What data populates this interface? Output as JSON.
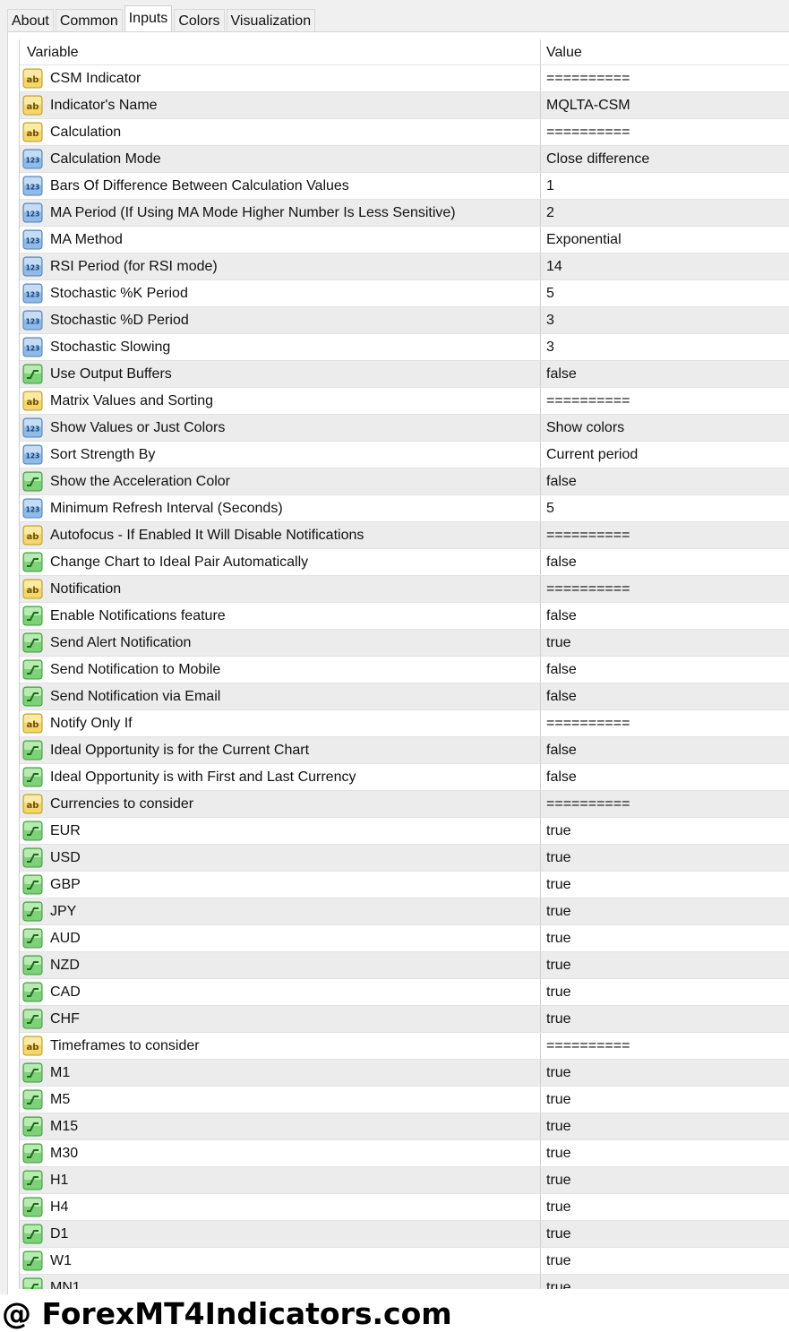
{
  "tabs": [
    {
      "label": "About",
      "active": false
    },
    {
      "label": "Common",
      "active": false
    },
    {
      "label": "Inputs",
      "active": true
    },
    {
      "label": "Colors",
      "active": false
    },
    {
      "label": "Visualization",
      "active": false
    }
  ],
  "table": {
    "header": {
      "variable": "Variable",
      "value": "Value"
    },
    "rows": [
      {
        "icon": "string-icon",
        "variable": "CSM Indicator",
        "value": "=========="
      },
      {
        "icon": "string-icon",
        "variable": "Indicator's Name",
        "value": "MQLTA-CSM"
      },
      {
        "icon": "string-icon",
        "variable": "Calculation",
        "value": "=========="
      },
      {
        "icon": "number-icon",
        "variable": "Calculation Mode",
        "value": "Close difference"
      },
      {
        "icon": "number-icon",
        "variable": "Bars Of Difference Between Calculation Values",
        "value": "1"
      },
      {
        "icon": "number-icon",
        "variable": "MA Period (If Using MA Mode Higher Number Is Less Sensitive)",
        "value": "2"
      },
      {
        "icon": "number-icon",
        "variable": "MA Method",
        "value": "Exponential"
      },
      {
        "icon": "number-icon",
        "variable": "RSI Period (for RSI mode)",
        "value": "14"
      },
      {
        "icon": "number-icon",
        "variable": "Stochastic %K Period",
        "value": "5"
      },
      {
        "icon": "number-icon",
        "variable": "Stochastic %D Period",
        "value": "3"
      },
      {
        "icon": "number-icon",
        "variable": "Stochastic Slowing",
        "value": "3"
      },
      {
        "icon": "boolean-icon",
        "variable": "Use Output Buffers",
        "value": "false"
      },
      {
        "icon": "string-icon",
        "variable": "Matrix Values and Sorting",
        "value": "=========="
      },
      {
        "icon": "number-icon",
        "variable": "Show Values or Just Colors",
        "value": "Show colors"
      },
      {
        "icon": "number-icon",
        "variable": "Sort Strength By",
        "value": "Current period"
      },
      {
        "icon": "boolean-icon",
        "variable": "Show the Acceleration Color",
        "value": "false"
      },
      {
        "icon": "number-icon",
        "variable": "Minimum Refresh Interval (Seconds)",
        "value": "5"
      },
      {
        "icon": "string-icon",
        "variable": "Autofocus - If Enabled It Will Disable Notifications",
        "value": "=========="
      },
      {
        "icon": "boolean-icon",
        "variable": "Change Chart to Ideal Pair Automatically",
        "value": "false"
      },
      {
        "icon": "string-icon",
        "variable": "Notification",
        "value": "=========="
      },
      {
        "icon": "boolean-icon",
        "variable": "Enable Notifications feature",
        "value": "false"
      },
      {
        "icon": "boolean-icon",
        "variable": "Send Alert Notification",
        "value": "true"
      },
      {
        "icon": "boolean-icon",
        "variable": "Send Notification to Mobile",
        "value": "false"
      },
      {
        "icon": "boolean-icon",
        "variable": "Send Notification via Email",
        "value": "false"
      },
      {
        "icon": "string-icon",
        "variable": "Notify Only If",
        "value": "=========="
      },
      {
        "icon": "boolean-icon",
        "variable": "Ideal Opportunity is for the Current Chart",
        "value": "false"
      },
      {
        "icon": "boolean-icon",
        "variable": "Ideal Opportunity is with First and Last Currency",
        "value": "false"
      },
      {
        "icon": "string-icon",
        "variable": "Currencies to consider",
        "value": "=========="
      },
      {
        "icon": "boolean-icon",
        "variable": "EUR",
        "value": "true"
      },
      {
        "icon": "boolean-icon",
        "variable": "USD",
        "value": "true"
      },
      {
        "icon": "boolean-icon",
        "variable": "GBP",
        "value": "true"
      },
      {
        "icon": "boolean-icon",
        "variable": "JPY",
        "value": "true"
      },
      {
        "icon": "boolean-icon",
        "variable": "AUD",
        "value": "true"
      },
      {
        "icon": "boolean-icon",
        "variable": "NZD",
        "value": "true"
      },
      {
        "icon": "boolean-icon",
        "variable": "CAD",
        "value": "true"
      },
      {
        "icon": "boolean-icon",
        "variable": "CHF",
        "value": "true"
      },
      {
        "icon": "string-icon",
        "variable": "Timeframes to consider",
        "value": "=========="
      },
      {
        "icon": "boolean-icon",
        "variable": "M1",
        "value": "true"
      },
      {
        "icon": "boolean-icon",
        "variable": "M5",
        "value": "true"
      },
      {
        "icon": "boolean-icon",
        "variable": "M15",
        "value": "true"
      },
      {
        "icon": "boolean-icon",
        "variable": "M30",
        "value": "true"
      },
      {
        "icon": "boolean-icon",
        "variable": "H1",
        "value": "true"
      },
      {
        "icon": "boolean-icon",
        "variable": "H4",
        "value": "true"
      },
      {
        "icon": "boolean-icon",
        "variable": "D1",
        "value": "true"
      },
      {
        "icon": "boolean-icon",
        "variable": "W1",
        "value": "true"
      },
      {
        "icon": "boolean-icon",
        "variable": "MN1",
        "value": "true"
      }
    ]
  },
  "watermark": "@ ForexMT4Indicators.com"
}
